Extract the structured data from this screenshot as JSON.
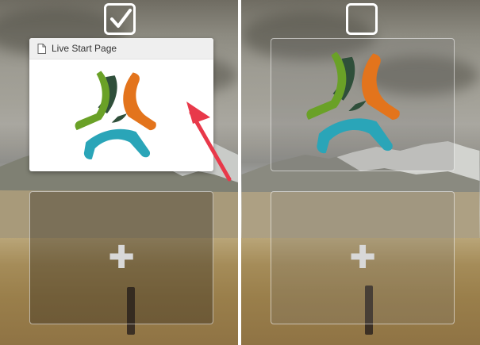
{
  "left_panel": {
    "checkbox_checked": true,
    "popup_title": "Live Start Page",
    "page_icon": "page-icon",
    "logo_icon": "app-logo-icon",
    "add_icon": "plus-icon",
    "arrow_color": "#e8394a"
  },
  "right_panel": {
    "checkbox_checked": false,
    "logo_icon": "app-logo-icon",
    "add_icon": "plus-icon"
  },
  "logo_colors": {
    "green": "#6aa127",
    "orange": "#e3741c",
    "teal": "#2aa5b8",
    "dark": "#2f4f3a"
  }
}
